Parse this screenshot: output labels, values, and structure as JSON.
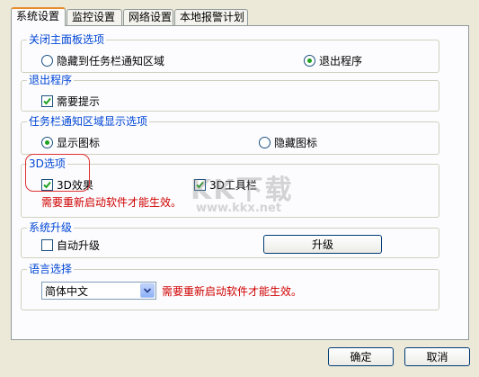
{
  "tabs": [
    {
      "label": "系统设置",
      "active": true
    },
    {
      "label": "监控设置",
      "active": false
    },
    {
      "label": "网络设置",
      "active": false
    },
    {
      "label": "本地报警计划",
      "active": false
    }
  ],
  "close_panel": {
    "title": "关闭主面板选项",
    "options": [
      {
        "label": "隐藏到任务栏通知区域",
        "selected": false
      },
      {
        "label": "退出程序",
        "selected": true
      }
    ]
  },
  "exit_program": {
    "title": "退出程序",
    "need_prompt": {
      "label": "需要提示",
      "checked": true
    }
  },
  "tray_display": {
    "title": "任务栏通知区域显示选项",
    "options": [
      {
        "label": "显示图标",
        "selected": true
      },
      {
        "label": "隐藏图标",
        "selected": false
      }
    ]
  },
  "options_3d": {
    "title": "3D选项",
    "effect": {
      "label": "3D效果",
      "checked": true
    },
    "toolbar": {
      "label": "3D工具栏",
      "checked": true
    },
    "warning": "需要重新启动软件才能生效。"
  },
  "upgrade": {
    "title": "系统升级",
    "auto": {
      "label": "自动升级",
      "checked": false
    },
    "button_label": "升级"
  },
  "language": {
    "title": "语言选择",
    "selected": "简体中文",
    "warning": "需要重新启动软件才能生效。"
  },
  "footer": {
    "ok_label": "确定",
    "cancel_label": "取消"
  },
  "watermark": {
    "logo": "KK下载",
    "url": "www.kkx.net"
  },
  "colors": {
    "accent": "#0046d5",
    "warning": "#d00000",
    "tab_highlight": "#e68b2c",
    "check": "#21a121"
  }
}
